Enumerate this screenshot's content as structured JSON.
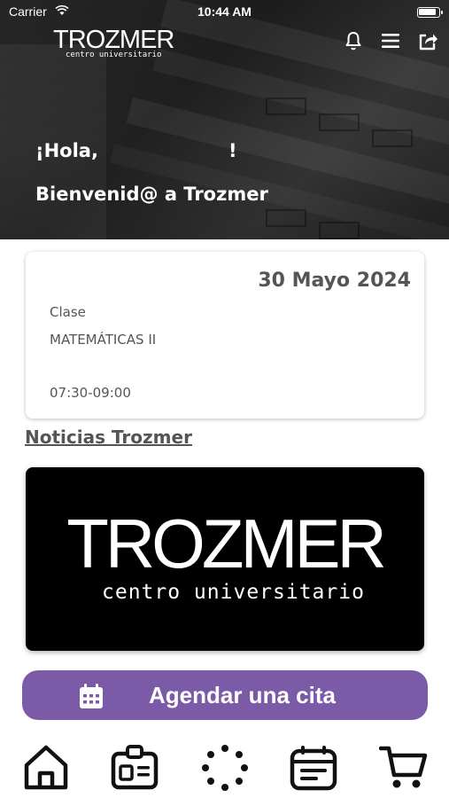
{
  "status_bar": {
    "carrier": "Carrier",
    "time": "10:44 AM"
  },
  "header": {
    "logo_word": "TROZMER",
    "logo_sub": "centro universitario",
    "icons": [
      "bell-icon",
      "menu-icon",
      "share-icon"
    ]
  },
  "greeting": {
    "hello": "¡Hola,",
    "exclaim": "!",
    "welcome": "Bienvenid@ a Trozmer"
  },
  "class_card": {
    "date": "30 Mayo 2024",
    "label": "Clase",
    "subject": "MATEMÁTICAS II",
    "hours": "07:30-09:00"
  },
  "news": {
    "title": "Noticias Trozmer",
    "banner_word": "TROZMER",
    "banner_sub": "centro universitario"
  },
  "cta": {
    "label": "Agendar una cita",
    "icon": "calendar-icon",
    "color": "#7b5aa8"
  },
  "tabbar": {
    "items": [
      "home-icon",
      "id-card-icon",
      "loading-icon",
      "schedule-icon",
      "cart-icon"
    ]
  }
}
